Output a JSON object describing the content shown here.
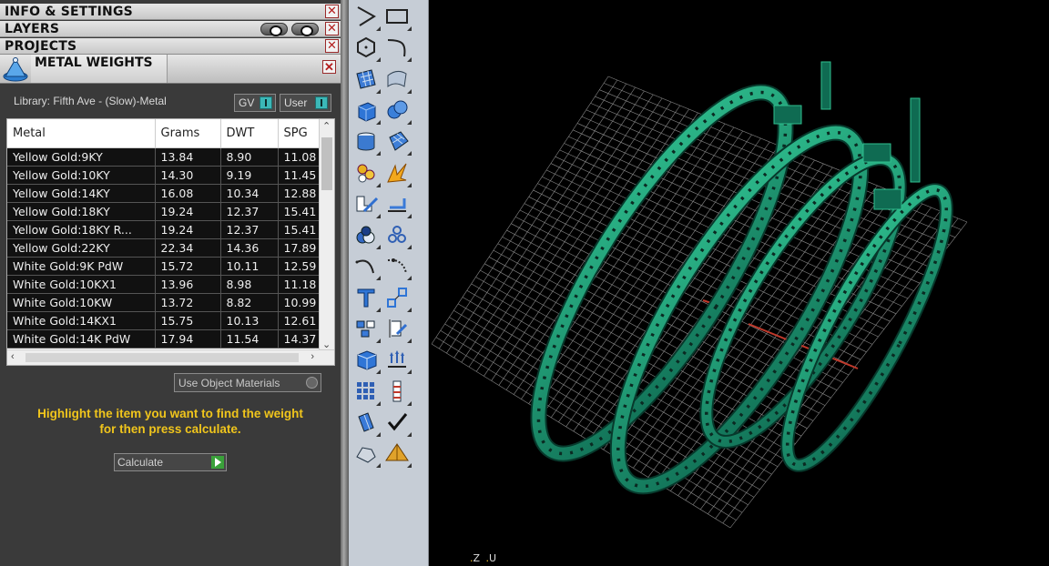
{
  "panel": {
    "sections": [
      {
        "label": "INFO & SETTINGS"
      },
      {
        "label": "LAYERS"
      },
      {
        "label": "PROJECTS"
      }
    ],
    "close_glyph": "✕",
    "metal_weights": {
      "title": "METAL WEIGHTS",
      "library_label": "Library: Fifth Ave - (Slow)-Metal",
      "gv_label": "GV",
      "user_label": "User",
      "columns": [
        "Metal",
        "Grams",
        "DWT",
        "SPG"
      ],
      "rows": [
        [
          "Yellow Gold:9KY",
          "13.84",
          "8.90",
          "11.08"
        ],
        [
          "Yellow Gold:10KY",
          "14.30",
          "9.19",
          "11.45"
        ],
        [
          "Yellow Gold:14KY",
          "16.08",
          "10.34",
          "12.88"
        ],
        [
          "Yellow Gold:18KY",
          "19.24",
          "12.37",
          "15.41"
        ],
        [
          "Yellow Gold:18KY R...",
          "19.24",
          "12.37",
          "15.41"
        ],
        [
          "Yellow Gold:22KY",
          "22.34",
          "14.36",
          "17.89"
        ],
        [
          "White Gold:9K PdW",
          "15.72",
          "10.11",
          "12.59"
        ],
        [
          "White Gold:10KX1",
          "13.96",
          "8.98",
          "11.18"
        ],
        [
          "White Gold:10KW",
          "13.72",
          "8.82",
          "10.99"
        ],
        [
          "White Gold:14KX1",
          "15.75",
          "10.13",
          "12.61"
        ],
        [
          "White Gold:14K PdW",
          "17.94",
          "11.54",
          "14.37"
        ]
      ],
      "use_object_materials_label": "Use Object Materials",
      "hint_line1": "Highlight the item you want to find the weight",
      "hint_line2": "for then press calculate.",
      "calculate_label": "Calculate"
    }
  },
  "toolbar": {
    "icons": [
      "polygon-curve-icon",
      "rectangle-icon",
      "hexagon-icon",
      "curve-icon",
      "surface-grid-icon",
      "surface-patch-icon",
      "box-icon",
      "spheres-icon",
      "cylinder-icon",
      "mesh-surface-icon",
      "gem-cluster-icon",
      "boolean-burst-icon",
      "extrude-icon",
      "offset-surface-icon",
      "drop-icon",
      "dots-icon",
      "arc-icon",
      "fillet-icon",
      "text-icon",
      "scale-icon",
      "array-icon",
      "mirror-icon",
      "cube-solid-icon",
      "project-arrows-icon",
      "grid-dots-icon",
      "column-icon",
      "prism-icon",
      "check-icon",
      "rock-icon",
      "pyramid-icon"
    ]
  },
  "viewport": {
    "axis_z": "Z",
    "axis_u": "U",
    "colors": {
      "ring": "#0f6b52",
      "ring_hi": "#2fbf8f",
      "grid": "#8a8a8a",
      "axis": "#c0392b"
    }
  }
}
